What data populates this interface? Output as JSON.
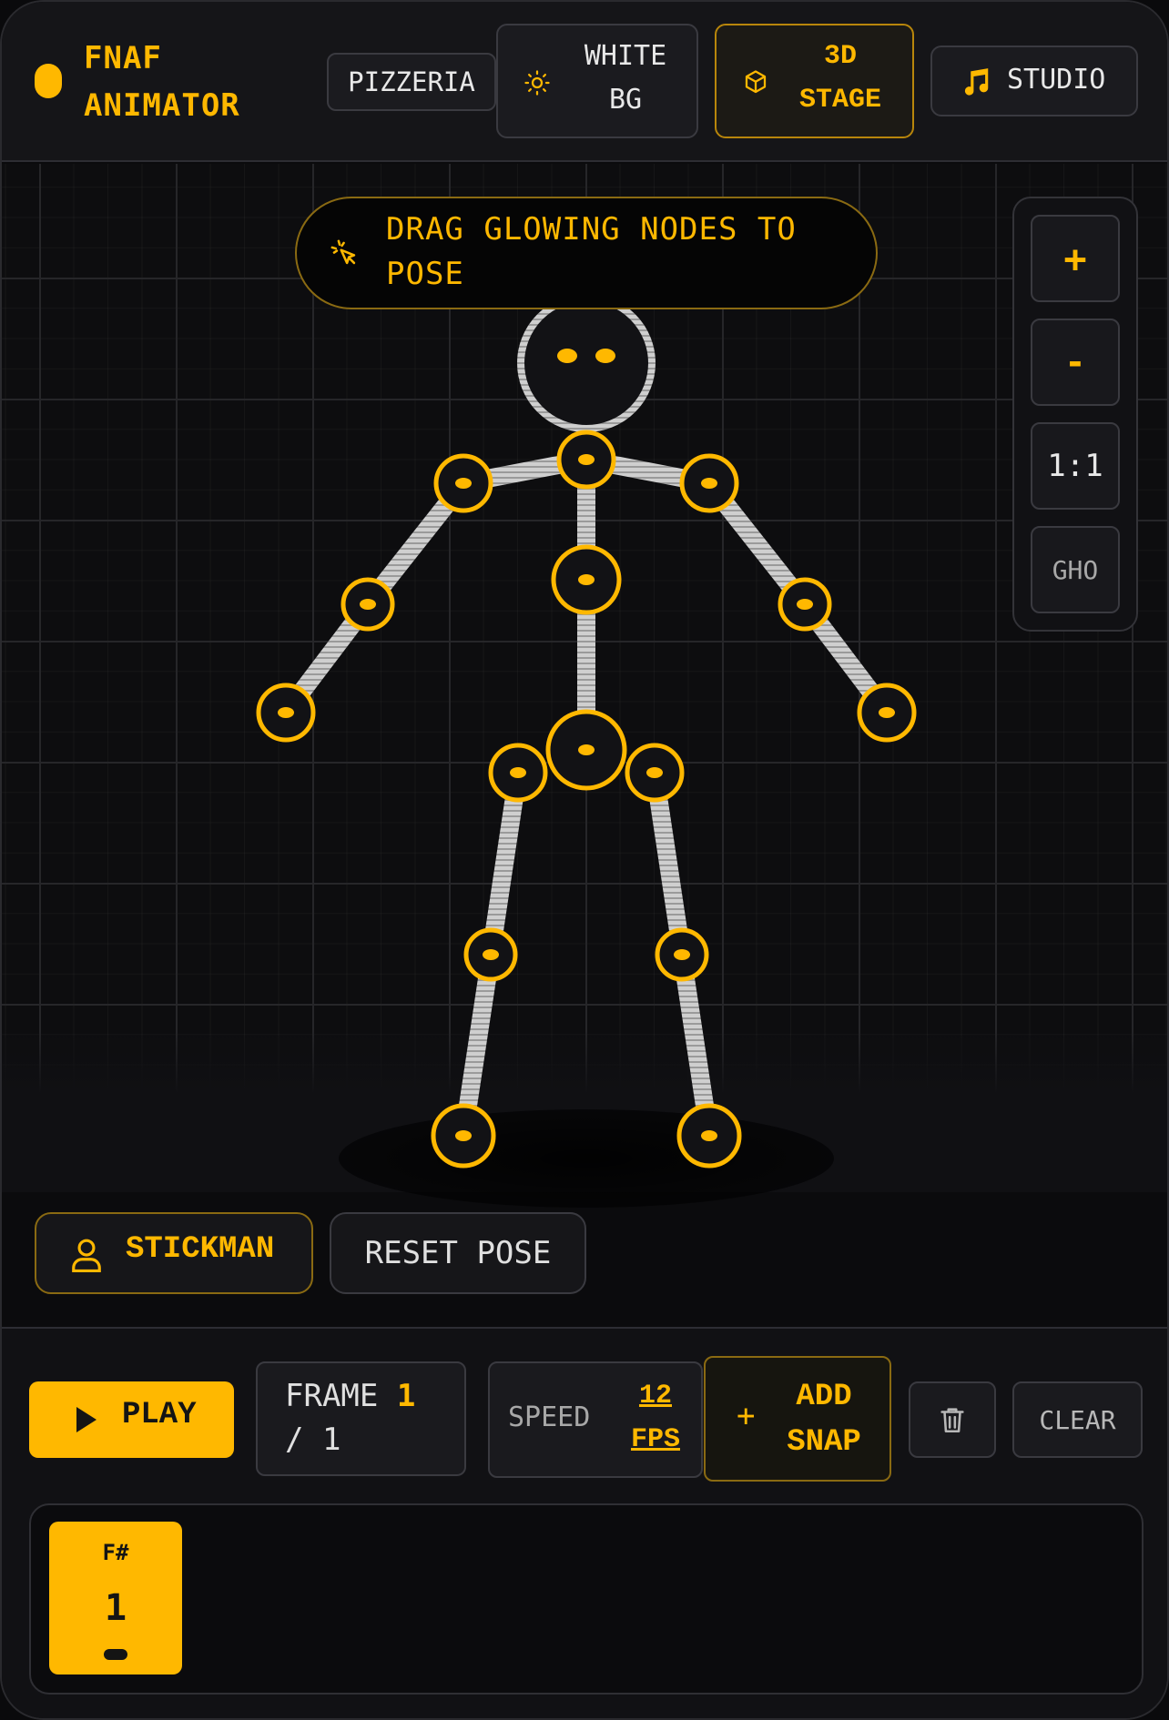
{
  "app": {
    "title_line1": "FNAF",
    "title_line2": "ANIMATOR"
  },
  "header": {
    "buttons": [
      {
        "label": "PIZZERIA"
      },
      {
        "label_line1": "WHITE",
        "label_line2": "BG",
        "icon": "sun-icon"
      },
      {
        "label_line1": "3D",
        "label_line2": "STAGE",
        "icon": "cube-icon",
        "active": true
      },
      {
        "label": "STUDIO",
        "icon": "music-note-icon"
      }
    ]
  },
  "stage": {
    "hint_line1": "DRAG GLOWING NODES TO",
    "hint_line2": "POSE",
    "zoom": {
      "zoom_in": "+",
      "zoom_out": "-",
      "reset": "1:1",
      "ghost": "GHO"
    },
    "character_button": "STICKMAN",
    "reset_button": "RESET POSE"
  },
  "controls": {
    "play_label": "PLAY",
    "frame_label": "FRAME",
    "frame_current": "1",
    "frame_total": "/ 1",
    "speed_label": "SPEED",
    "speed_value": "12",
    "speed_unit": "FPS",
    "add_snap_line1": "ADD",
    "add_snap_line2": "SNAP",
    "clear_label": "CLEAR"
  },
  "timeline": {
    "frames": [
      {
        "tag": "F#",
        "number": "1"
      }
    ]
  },
  "colors": {
    "accent": "#ffb800",
    "background": "#0b0b0d",
    "bone": "#d0d0d0"
  }
}
